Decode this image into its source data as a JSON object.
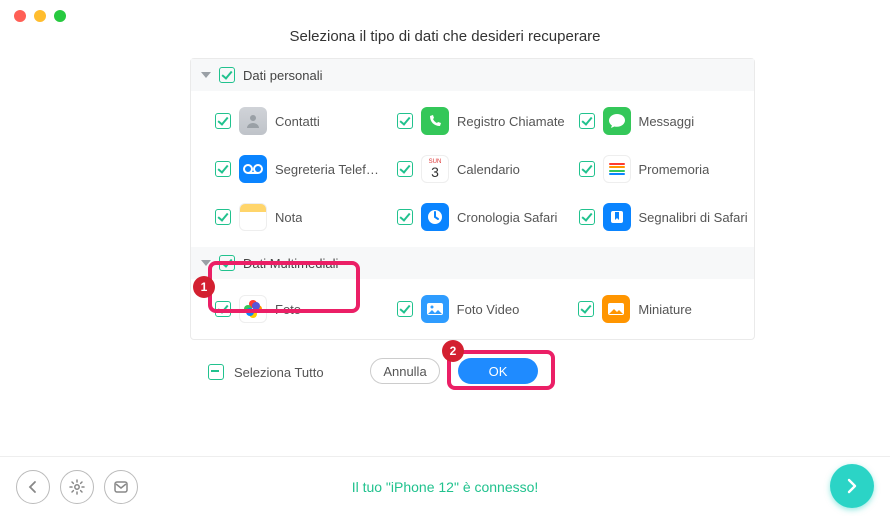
{
  "title": "Seleziona il tipo di dati che desideri recuperare",
  "groups": {
    "personal": {
      "title": "Dati personali",
      "items": [
        {
          "label": "Contatti"
        },
        {
          "label": "Registro Chiamate"
        },
        {
          "label": "Messaggi"
        },
        {
          "label": "Segreteria Telefoni..."
        },
        {
          "label": "Calendario"
        },
        {
          "label": "Promemoria"
        },
        {
          "label": "Nota"
        },
        {
          "label": "Cronologia Safari"
        },
        {
          "label": "Segnalibri di Safari"
        }
      ]
    },
    "media": {
      "title": "Dati Multimediali",
      "items": [
        {
          "label": "Foto"
        },
        {
          "label": "Foto Video"
        },
        {
          "label": "Miniature"
        }
      ]
    }
  },
  "select_all": "Seleziona Tutto",
  "buttons": {
    "cancel": "Annulla",
    "ok": "OK"
  },
  "footer": "Il tuo \"iPhone 12\" è connesso!",
  "calendar_day": "3",
  "annotations": {
    "step1": "1",
    "step2": "2"
  }
}
